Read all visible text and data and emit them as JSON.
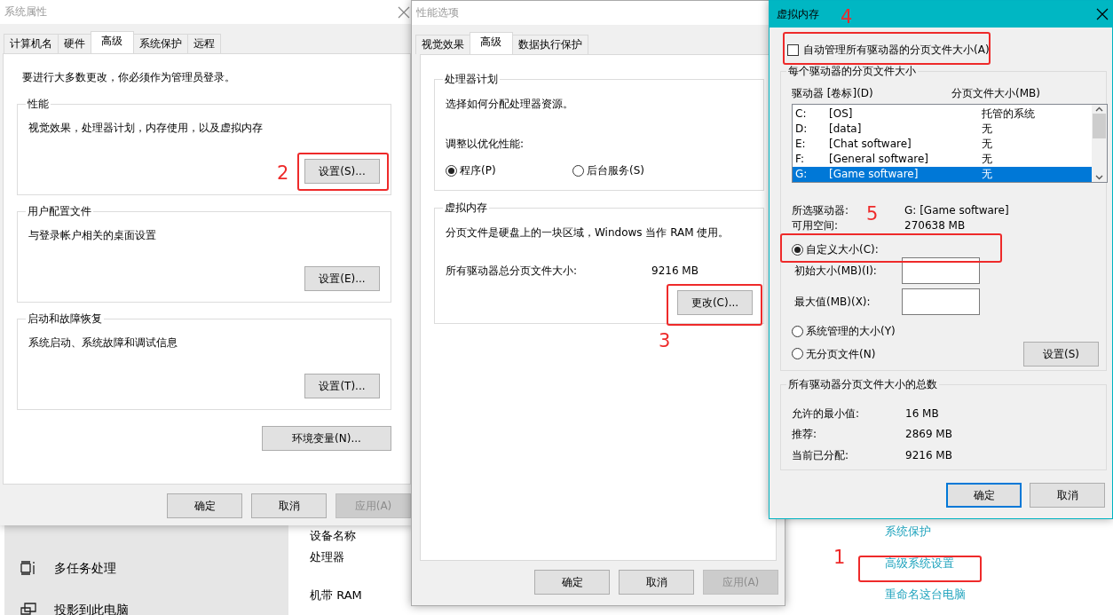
{
  "background": {
    "sidebar_items": [
      {
        "label": "多任务处理"
      },
      {
        "label": "投影到此电脑"
      }
    ],
    "specs": [
      "设备名称",
      "处理器",
      "机带 RAM"
    ],
    "links": [
      "系统保护",
      "高级系统设置",
      "重命名这台电脑"
    ]
  },
  "system_properties": {
    "title": "系统属性",
    "tabs": [
      {
        "label": "计算机名",
        "selected": false
      },
      {
        "label": "硬件",
        "selected": false
      },
      {
        "label": "高级",
        "selected": true
      },
      {
        "label": "系统保护",
        "selected": false
      },
      {
        "label": "远程",
        "selected": false
      }
    ],
    "admin_note": "要进行大多数更改，你必须作为管理员登录。",
    "groups": [
      {
        "title": "性能",
        "description": "视觉效果，处理器计划，内存使用，以及虚拟内存",
        "button": "设置(S)..."
      },
      {
        "title": "用户配置文件",
        "description": "与登录帐户相关的桌面设置",
        "button": "设置(E)..."
      },
      {
        "title": "启动和故障恢复",
        "description": "系统启动、系统故障和调试信息",
        "button": "设置(T)..."
      }
    ],
    "env_button": "环境变量(N)...",
    "buttons": [
      {
        "label": "确定",
        "disabled": false
      },
      {
        "label": "取消",
        "disabled": false
      },
      {
        "label": "应用(A)",
        "disabled": true
      }
    ]
  },
  "performance_options": {
    "title": "性能选项",
    "tabs": [
      {
        "label": "视觉效果",
        "selected": false
      },
      {
        "label": "高级",
        "selected": true
      },
      {
        "label": "数据执行保护",
        "selected": false
      }
    ],
    "processor_group": {
      "title": "处理器计划",
      "description": "选择如何分配处理器资源。",
      "prompt": "调整以优化性能:",
      "options": [
        {
          "label": "程序(P)",
          "selected": true
        },
        {
          "label": "后台服务(S)",
          "selected": false
        }
      ]
    },
    "vm_group": {
      "title": "虚拟内存",
      "description": "分页文件是硬盘上的一块区域，Windows 当作 RAM 使用。",
      "total_label": "所有驱动器总分页文件大小:",
      "total_value": "9216 MB",
      "button": "更改(C)..."
    },
    "buttons": [
      {
        "label": "确定",
        "disabled": false
      },
      {
        "label": "取消",
        "disabled": false
      },
      {
        "label": "应用(A)",
        "disabled": true
      }
    ]
  },
  "virtual_memory": {
    "title": "虚拟内存",
    "auto_manage": {
      "label": "自动管理所有驱动器的分页文件大小(A)",
      "checked": false
    },
    "per_drive": {
      "title": "每个驱动器的分页文件大小",
      "column_drive": "驱动器 [卷标](D)",
      "column_size": "分页文件大小(MB)",
      "drives": [
        {
          "letter": "C:",
          "label": "[OS]",
          "size": "托管的系统",
          "selected": false
        },
        {
          "letter": "D:",
          "label": "[data]",
          "size": "无",
          "selected": false
        },
        {
          "letter": "E:",
          "label": "[Chat software]",
          "size": "无",
          "selected": false
        },
        {
          "letter": "F:",
          "label": "[General software]",
          "size": "无",
          "selected": false
        },
        {
          "letter": "G:",
          "label": "[Game software]",
          "size": "无",
          "selected": true
        }
      ],
      "selected_drive_label": "所选驱动器:",
      "selected_drive_value": "G:  [Game software]",
      "free_space_label": "可用空间:",
      "free_space_value": "270638 MB",
      "custom_size": {
        "label": "自定义大小(C):",
        "selected": true
      },
      "initial_label": "初始大小(MB)(I):",
      "max_label": "最大值(MB)(X):",
      "system_managed": {
        "label": "系统管理的大小(Y)",
        "selected": false
      },
      "no_paging": {
        "label": "无分页文件(N)",
        "selected": false
      },
      "set_button": "设置(S)"
    },
    "totals": {
      "title": "所有驱动器分页文件大小的总数",
      "rows": [
        {
          "label": "允许的最小值:",
          "value": "16 MB"
        },
        {
          "label": "推荐:",
          "value": "2869 MB"
        },
        {
          "label": "当前已分配:",
          "value": "9216 MB"
        }
      ]
    },
    "buttons": [
      {
        "label": "确定",
        "default": true
      },
      {
        "label": "取消",
        "default": false
      }
    ]
  },
  "annotations": [
    "1",
    "2",
    "3",
    "4",
    "5"
  ]
}
